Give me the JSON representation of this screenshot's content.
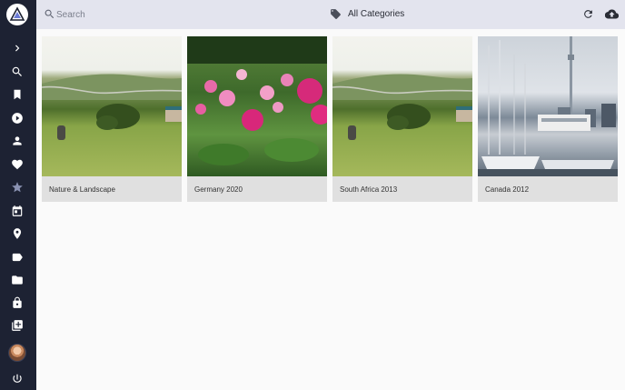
{
  "colors": {
    "sidebar_bg": "#1d2233",
    "topbar_bg": "#e3e4ee",
    "content_bg": "#fafafa",
    "card_bg": "#e0e0e0"
  },
  "sidebar": {
    "icons": [
      "logo-icon",
      "expand-icon",
      "search-icon",
      "bookmark-icon",
      "play-icon",
      "person-icon",
      "heart-icon",
      "star-icon",
      "calendar-icon",
      "location-icon",
      "label-icon",
      "folder-icon",
      "lock-icon",
      "library-icon",
      "avatar",
      "power-icon"
    ]
  },
  "search": {
    "placeholder": "Search"
  },
  "category": {
    "label": "All Categories"
  },
  "albums": [
    {
      "title": "Nature & Landscape"
    },
    {
      "title": "Germany 2020"
    },
    {
      "title": "South Africa 2013"
    },
    {
      "title": "Canada 2012"
    }
  ]
}
